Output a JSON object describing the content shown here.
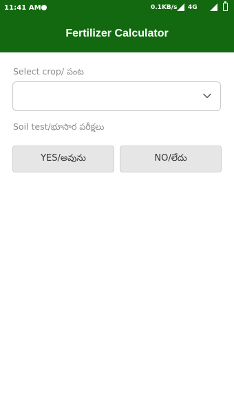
{
  "status_bar": {
    "time": "11:41 AM",
    "net_speed": "0.1KB/s",
    "net_type": "4G"
  },
  "app_bar": {
    "title": "Fertilizer Calculator",
    "color": "#13690f"
  },
  "form": {
    "crop_label": "Select crop/ పంట",
    "crop_value": "",
    "soil_test_label": "Soil test/భూసార పరీక్షలు",
    "yes_label": "YES/అవును",
    "no_label": "NO/లేదు"
  },
  "icons": {
    "dropdown": "chevron-down-icon",
    "signal": "signal-icon",
    "battery": "battery-icon"
  }
}
